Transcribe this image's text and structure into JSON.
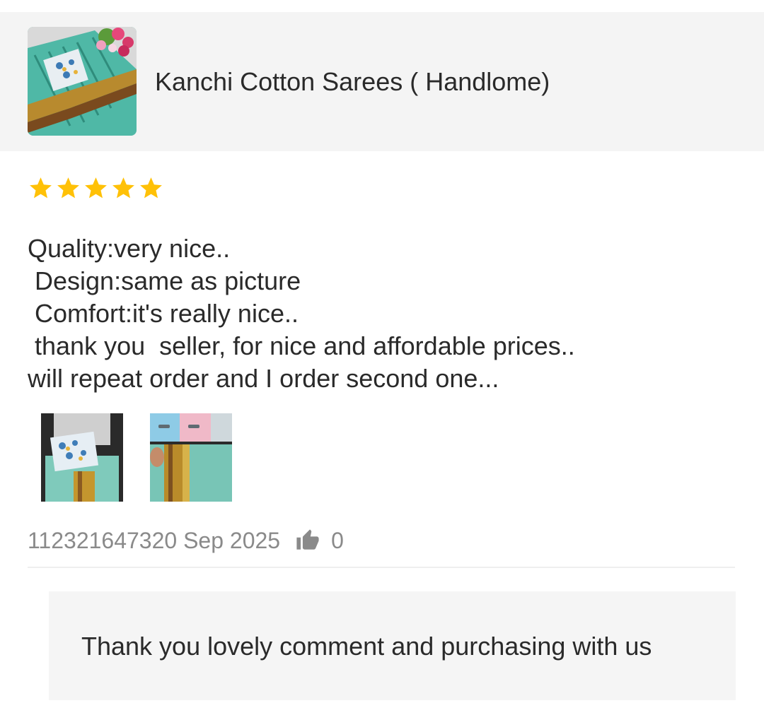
{
  "product": {
    "title": "Kanchi Cotton Sarees ( Handlome)",
    "image_icon": "product-image"
  },
  "review": {
    "rating": 5,
    "rating_max": 5,
    "star_color": "#FFC107",
    "text": "Quality:very nice..\n Design:same as picture\n Comfort:it's really nice..\n thank you  seller, for nice and affordable prices..\nwill repeat order and I order second one...",
    "photos": [
      "review-photo-1",
      "review-photo-2"
    ],
    "meta": "112321647320 Sep 2025",
    "like_count": "0",
    "like_icon": "thumbs-up-icon"
  },
  "seller_reply": {
    "text": "Thank you lovely comment and purchasing with us"
  }
}
